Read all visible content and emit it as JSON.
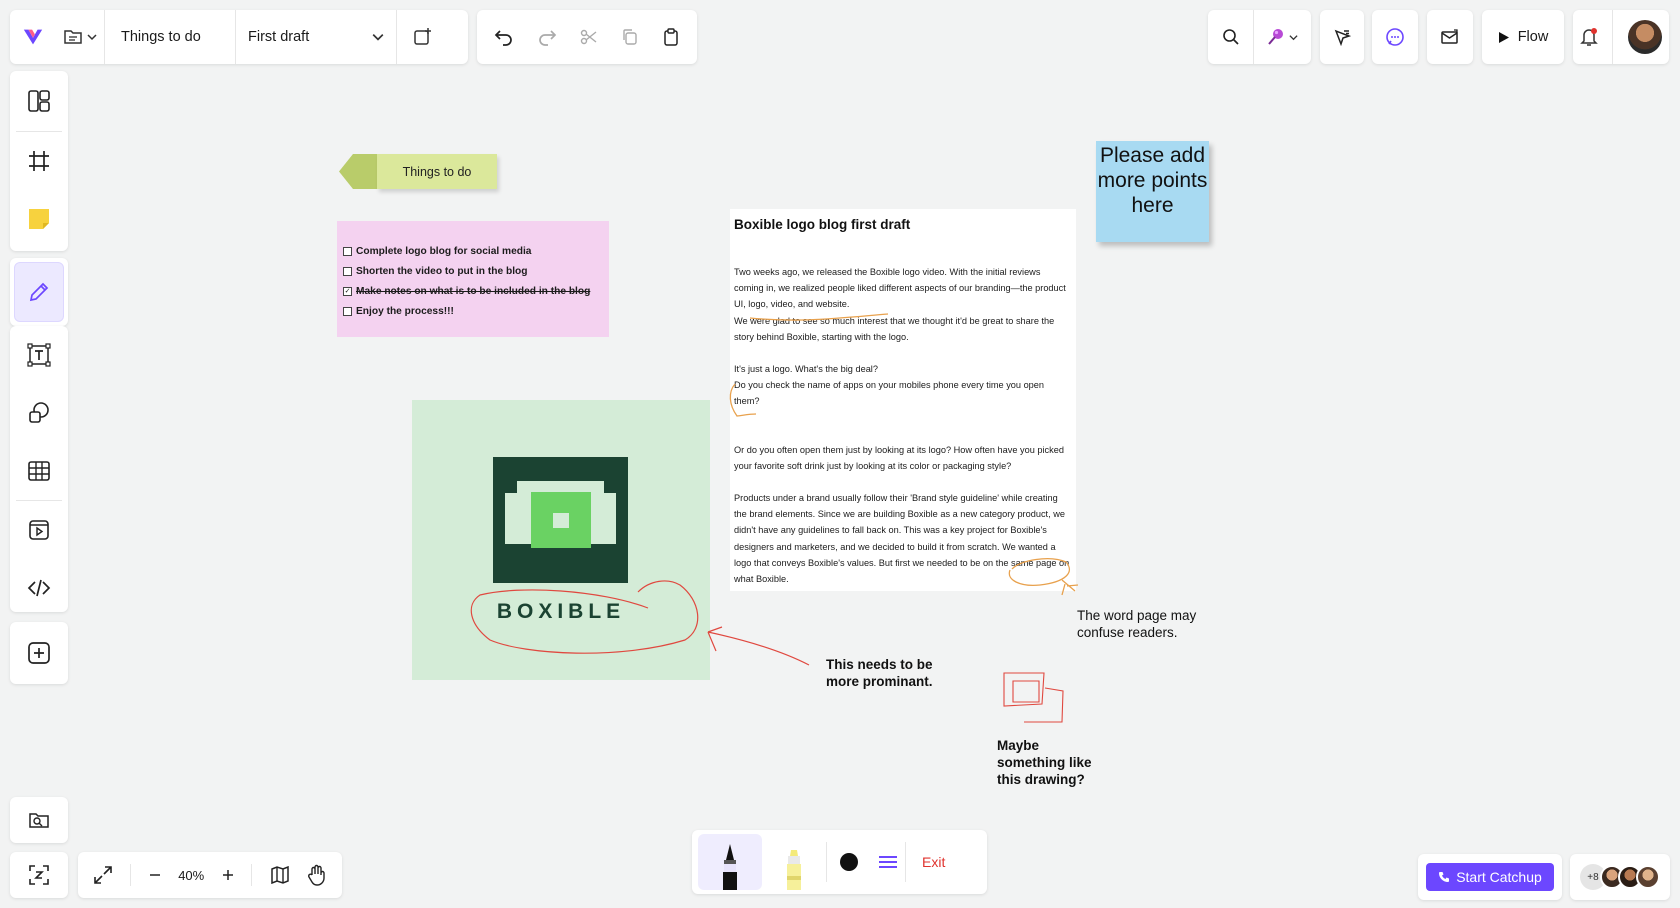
{
  "topbar": {
    "document_title": "Things to do",
    "current_page": "First draft",
    "flow_label": "Flow"
  },
  "board": {
    "tag_label": "Things to do",
    "todo_items": [
      {
        "text": "Complete logo blog for social media",
        "checked": false
      },
      {
        "text": "Shorten the video to put in the blog",
        "checked": false
      },
      {
        "text": "Make notes on what is to be included in the blog",
        "checked": true
      },
      {
        "text": "Enjoy the process!!!",
        "checked": false
      }
    ],
    "blue_note": "Please add more points here",
    "logo_wordmark": "BOXIBLE",
    "doc_title": "Boxible logo blog first draft",
    "doc_paragraphs": [
      "Two weeks ago, we released the Boxible logo video. With the initial reviews coming in, we realized people liked different aspects of our branding—the product UI, logo, video, and website.",
      "We were glad to see so much interest that we thought it'd be great to share the story behind Boxible, starting with the logo.",
      "It's just a logo. What's the big deal?",
      "Do you check the name of apps on your mobiles  phone every time you open them?",
      "Or do you often open them just by looking at its logo? How often have you picked your favorite soft drink just by looking at its color or packaging style?",
      "Products under a brand usually follow their 'Brand style guideline'  while creating the brand elements. Since we are building Boxible as a new category product, we didn't have any guidelines to fall back on. This was a key project for Boxible's designers and marketers, and we decided to build it from scratch. We wanted a logo that conveys Boxible's values. But first we needed to be on the same page on what Boxible."
    ],
    "comment_page": "The word page may confuse readers.",
    "comment_prominent": "This needs to be more prominant.",
    "comment_drawing": "Maybe something like this drawing?"
  },
  "zoom": {
    "level": "40%"
  },
  "draw_toolbar": {
    "exit_label": "Exit",
    "active_color": "#111111"
  },
  "catchup": {
    "label": "Start Catchup"
  },
  "collaborators": {
    "extra_count": "+8"
  },
  "colors": {
    "accent": "#6c47ff",
    "todo_note": "#f4d2f0",
    "blue_note": "#a8daf2",
    "tag": "#dbe89b",
    "logo_card": "#d4ecd7",
    "logo_dark": "#1b4332",
    "logo_green": "#6ad263",
    "annotation_orange": "#e8a14d",
    "annotation_red": "#e0483f",
    "exit_red": "#e0332e"
  },
  "icons": [
    "app-logo-icon",
    "folder-icon",
    "chevron-down-icon",
    "add-page-icon",
    "undo-icon",
    "redo-icon",
    "scissors-icon",
    "copy-icon",
    "clipboard-icon",
    "search-icon",
    "pin-icon",
    "cursor-icon",
    "chat-icon",
    "mail-icon",
    "play-icon",
    "bell-icon",
    "layout-icon",
    "frame-icon",
    "sticky-note-icon",
    "pencil-icon",
    "text-icon",
    "shapes-icon",
    "table-icon",
    "media-icon",
    "code-icon",
    "add-icon",
    "gallery-icon",
    "fit-icon",
    "expand-icon",
    "minus-icon",
    "plus-icon",
    "map-icon",
    "hand-icon",
    "pen-icon",
    "highlighter-icon",
    "stroke-width-icon",
    "phone-icon"
  ]
}
